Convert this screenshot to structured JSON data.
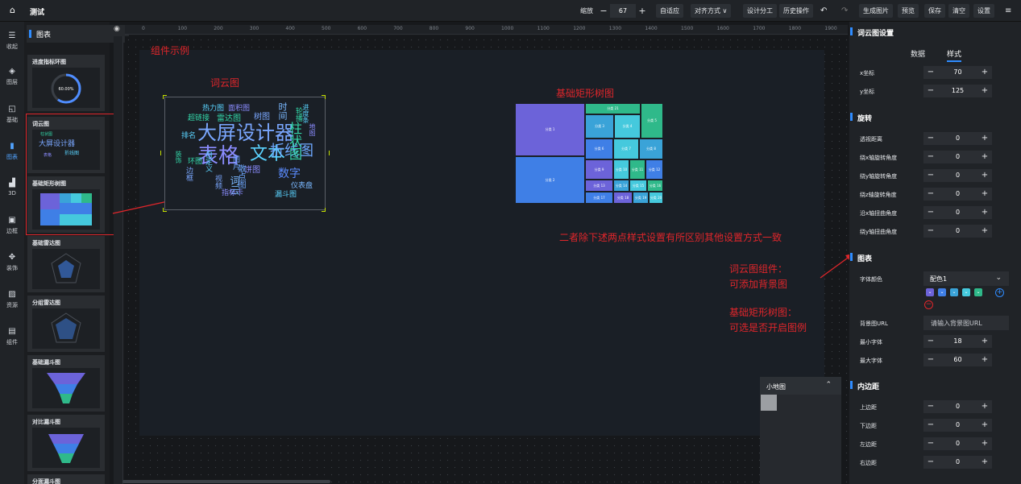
{
  "app": {
    "title": "测试"
  },
  "toolbar": {
    "zoom_label": "缩放",
    "zoom_value": "67",
    "zoom_minus": "−",
    "zoom_plus": "+",
    "fit": "自适应",
    "align": "对齐方式",
    "align_chevron": "∨",
    "design_split": "设计分工",
    "history": "历史操作",
    "undo": "↶",
    "redo": "↷",
    "generate_image": "生成图片",
    "preview": "预览",
    "save": "保存",
    "clear": "清空",
    "settings": "设置",
    "menu": "≡"
  },
  "rail": {
    "items": [
      {
        "label": "收起",
        "icon": "☰"
      },
      {
        "label": "图层",
        "icon": "◈"
      },
      {
        "label": "基础",
        "icon": "◱"
      },
      {
        "label": "图表",
        "icon": "▮"
      },
      {
        "label": "3D",
        "icon": "▟"
      },
      {
        "label": "边框",
        "icon": "▣"
      },
      {
        "label": "装饰",
        "icon": "✥"
      },
      {
        "label": "资源",
        "icon": "▨"
      },
      {
        "label": "组件",
        "icon": "▤"
      }
    ]
  },
  "panel": {
    "title": "图表",
    "cards": [
      {
        "name": "进度指标环图",
        "value": "60.00%"
      },
      {
        "name": "词云图"
      },
      {
        "name": "基础矩形树图"
      },
      {
        "name": "基础雷达图"
      },
      {
        "name": "分组雷达图"
      },
      {
        "name": "基础漏斗图"
      },
      {
        "name": "对比漏斗图"
      },
      {
        "name": "分面漏斗图"
      }
    ]
  },
  "ruler": {
    "marks": [
      "0",
      "100",
      "200",
      "300",
      "400",
      "500",
      "600",
      "700",
      "800",
      "900",
      "1000",
      "1100",
      "1200",
      "1300",
      "1400",
      "1500",
      "1600",
      "1700",
      "1800",
      "1900"
    ]
  },
  "canvas": {
    "annotation_title": "组件示例",
    "wordcloud_label": "词云图",
    "treemap_label": "基础矩形树图",
    "note_main": "二者除下述两点样式设置有所区别其他设置方式一致",
    "note_wc_title": "词云图组件：",
    "note_wc_body": "可添加背景图",
    "note_tm_title": "基础矩形树图：",
    "note_tm_body": "可选是否开启图例",
    "wordcloud_words": [
      {
        "t": "大屏设计器",
        "c": "#7aa7ff"
      },
      {
        "t": "文本",
        "c": "#5ad3ff"
      },
      {
        "t": "表格",
        "c": "#8b8cff"
      },
      {
        "t": "折线图",
        "c": "#6ea8ff"
      },
      {
        "t": "柱状图",
        "c": "#33d6a8"
      },
      {
        "t": "数字",
        "c": "#5b8cff"
      },
      {
        "t": "词云",
        "c": "#7ab8ff"
      },
      {
        "t": "热力图",
        "c": "#5ad3ff"
      },
      {
        "t": "面积图",
        "c": "#8b8cff"
      },
      {
        "t": "雷达图",
        "c": "#33d6a8"
      },
      {
        "t": "超链接",
        "c": "#33d6a8"
      },
      {
        "t": "树图",
        "c": "#7aa7ff"
      },
      {
        "t": "排名",
        "c": "#5ad3ff"
      },
      {
        "t": "饼图",
        "c": "#8b8cff"
      },
      {
        "t": "散点图",
        "c": "#6ea8ff"
      },
      {
        "t": "仪表盘",
        "c": "#7ab8ff"
      },
      {
        "t": "漏斗图",
        "c": "#5ad3ff"
      },
      {
        "t": "指标卡",
        "c": "#8b8cff"
      },
      {
        "t": "环图",
        "c": "#33d6a8"
      },
      {
        "t": "视频",
        "c": "#7aa7ff"
      },
      {
        "t": "时间",
        "c": "#7ab8ff"
      },
      {
        "t": "轮播",
        "c": "#33d6a8"
      },
      {
        "t": "进度条",
        "c": "#5ad3ff"
      },
      {
        "t": "地图",
        "c": "#8b8cff"
      },
      {
        "t": "图片",
        "c": "#6ea8ff"
      },
      {
        "t": "自定义",
        "c": "#5ad3ff"
      },
      {
        "t": "边框",
        "c": "#7aa7ff"
      },
      {
        "t": "装饰",
        "c": "#33d6a8"
      }
    ],
    "treemap_cells": [
      "分类 1",
      "分类 2",
      "分类 3",
      "分类 4",
      "分类 5",
      "分类 6",
      "分类 7",
      "分类 8",
      "分类 9",
      "分类 10",
      "分类 11",
      "分类 12",
      "分类 13",
      "分类 14",
      "分类 15",
      "分类 16",
      "分类 17",
      "分类 18",
      "分类 19",
      "分类 20",
      "分类 21"
    ]
  },
  "minimap": {
    "title": "小地图",
    "collapse": "⌃"
  },
  "settings": {
    "title": "词云图设置",
    "tabs": [
      "数据",
      "样式"
    ],
    "x_label": "x坐标",
    "x_value": "70",
    "y_label": "y坐标",
    "y_value": "125",
    "rotate_section": "旋转",
    "perspective_label": "透视距离",
    "perspective_value": "0",
    "rot_x_label": "绕x轴旋转角度",
    "rot_x_value": "0",
    "rot_y_label": "绕y轴旋转角度",
    "rot_y_value": "0",
    "rot_z_label": "绕z轴旋转角度",
    "rot_z_value": "0",
    "skew_x_label": "沿x轴扭曲角度",
    "skew_x_value": "0",
    "skew_y_label": "绕y轴扭曲角度",
    "skew_y_value": "0",
    "chart_section": "图表",
    "font_color_label": "字体颜色",
    "font_color_value": "配色1",
    "bg_url_label": "背景图URL",
    "bg_url_placeholder": "请输入背景图URL",
    "min_font_label": "最小字体",
    "min_font_value": "18",
    "max_font_label": "最大字体",
    "max_font_value": "60",
    "padding_section": "内边距",
    "pad_top_label": "上边距",
    "pad_top_value": "0",
    "pad_bottom_label": "下边距",
    "pad_bottom_value": "0",
    "pad_left_label": "左边距",
    "pad_left_value": "0",
    "pad_right_label": "右边距",
    "pad_right_value": "0",
    "swatch_colors": [
      "#6c63d9",
      "#3f7fe6",
      "#3aa3d8",
      "#45c9dd",
      "#2fb98a"
    ],
    "minus": "−",
    "plus": "+"
  }
}
